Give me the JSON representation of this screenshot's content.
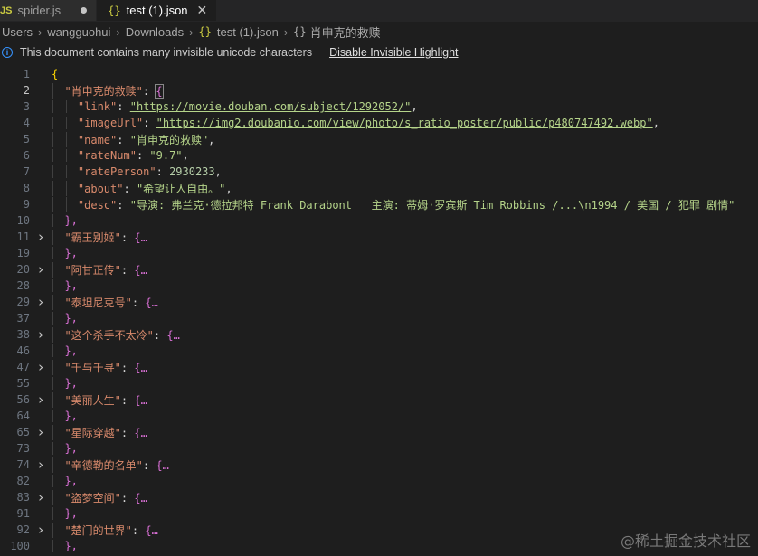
{
  "tabs": [
    {
      "badge": "JS",
      "label": "spider.js",
      "modified": true
    },
    {
      "icon": "{}",
      "label": "test (1).json",
      "close": "✕"
    }
  ],
  "breadcrumb": {
    "parts": [
      "Users",
      "wangguohui",
      "Downloads"
    ],
    "file_icon": "{}",
    "file": "test (1).json",
    "obj_icon": "{}",
    "symbol": "肖申克的救赎"
  },
  "banner": {
    "message": "This document contains many invisible unicode characters",
    "action": "Disable Invisible Highlight"
  },
  "editor": {
    "lines": [
      {
        "n": "1",
        "text": "{"
      },
      {
        "n": "2",
        "key": "\"肖申克的救赎\"",
        "open": "{"
      },
      {
        "n": "3",
        "key": "\"link\"",
        "value": "\"https://movie.douban.com/subject/1292052/\"",
        "comma": ","
      },
      {
        "n": "4",
        "key": "\"imageUrl\"",
        "value": "\"https://img2.doubanio.com/view/photo/s_ratio_poster/public/p480747492.webp\"",
        "comma": ","
      },
      {
        "n": "5",
        "key": "\"name\"",
        "value": "\"肖申克的救赎\"",
        "comma": ","
      },
      {
        "n": "6",
        "key": "\"rateNum\"",
        "value": "\"9.7\"",
        "comma": ","
      },
      {
        "n": "7",
        "key": "\"ratePerson\"",
        "value": "2930233",
        "comma": ","
      },
      {
        "n": "8",
        "key": "\"about\"",
        "value": "\"希望让人自由。\"",
        "comma": ","
      },
      {
        "n": "9",
        "key": "\"desc\"",
        "value": "\"导演: 弗兰克·德拉邦特 Frank Darabont   主演: 蒂姆·罗宾斯 Tim Robbins /...\\n1994 / 美国 / 犯罪 剧情\""
      },
      {
        "n": "10",
        "close": "},"
      },
      {
        "n": "11",
        "key": "\"霸王别姬\"",
        "folded": "{…"
      },
      {
        "n": "19",
        "close": "},"
      },
      {
        "n": "20",
        "key": "\"阿甘正传\"",
        "folded": "{…"
      },
      {
        "n": "28",
        "close": "},"
      },
      {
        "n": "29",
        "key": "\"泰坦尼克号\"",
        "folded": "{…"
      },
      {
        "n": "37",
        "close": "},"
      },
      {
        "n": "38",
        "key": "\"这个杀手不太冷\"",
        "folded": "{…"
      },
      {
        "n": "46",
        "close": "},"
      },
      {
        "n": "47",
        "key": "\"千与千寻\"",
        "folded": "{…"
      },
      {
        "n": "55",
        "close": "},"
      },
      {
        "n": "56",
        "key": "\"美丽人生\"",
        "folded": "{…"
      },
      {
        "n": "64",
        "close": "},"
      },
      {
        "n": "65",
        "key": "\"星际穿越\"",
        "folded": "{…"
      },
      {
        "n": "73",
        "close": "},"
      },
      {
        "n": "74",
        "key": "\"辛德勒的名单\"",
        "folded": "{…"
      },
      {
        "n": "82",
        "close": "},"
      },
      {
        "n": "83",
        "key": "\"盗梦空间\"",
        "folded": "{…"
      },
      {
        "n": "91",
        "close": "},"
      },
      {
        "n": "92",
        "key": "\"楚门的世界\"",
        "folded": "{…"
      },
      {
        "n": "100",
        "close": "},"
      }
    ]
  },
  "watermark": "@稀土掘金技术社区",
  "colors": {
    "background": "#1e1e1e",
    "key": "#d98a6c",
    "string": "#b5d48a",
    "bracket_outer": "#ffd700",
    "bracket_inner": "#da70d6",
    "info": "#3794ff"
  }
}
